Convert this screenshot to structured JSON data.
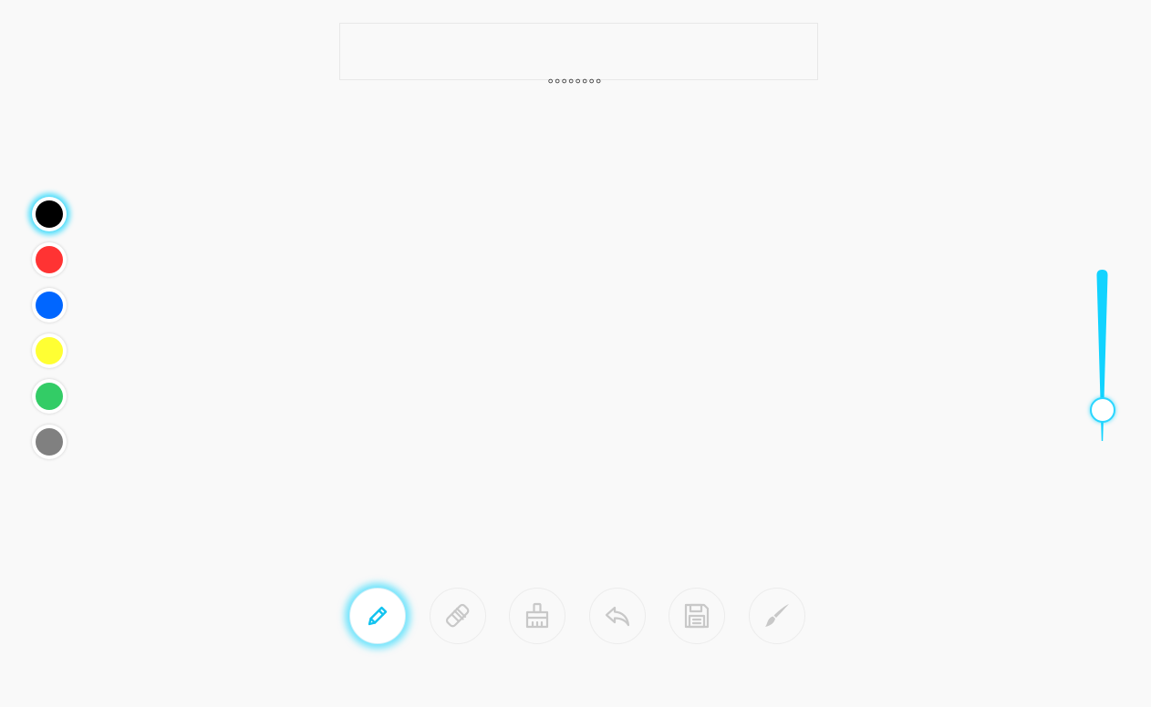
{
  "header": {
    "text": "。。。。。。。。"
  },
  "palette": {
    "colors": [
      {
        "name": "black",
        "hex": "#000000",
        "selected": true
      },
      {
        "name": "red",
        "hex": "#ff3333",
        "selected": false
      },
      {
        "name": "blue",
        "hex": "#0066ff",
        "selected": false
      },
      {
        "name": "yellow",
        "hex": "#ffff33",
        "selected": false
      },
      {
        "name": "green",
        "hex": "#33cc66",
        "selected": false
      },
      {
        "name": "gray",
        "hex": "#808080",
        "selected": false
      }
    ]
  },
  "brush_size": {
    "value": 0.18,
    "accent": "#12d3ff"
  },
  "toolbar": {
    "tools": [
      {
        "name": "pencil-icon",
        "active": true
      },
      {
        "name": "eraser-icon",
        "active": false
      },
      {
        "name": "broom-icon",
        "active": false
      },
      {
        "name": "undo-icon",
        "active": false
      },
      {
        "name": "save-icon",
        "active": false
      },
      {
        "name": "brush-icon",
        "active": false
      }
    ]
  },
  "colors": {
    "background": "#f9f9f9",
    "accent": "#12d3ff",
    "icon_inactive": "#c8c8c8",
    "icon_active": "#12c3ef"
  }
}
